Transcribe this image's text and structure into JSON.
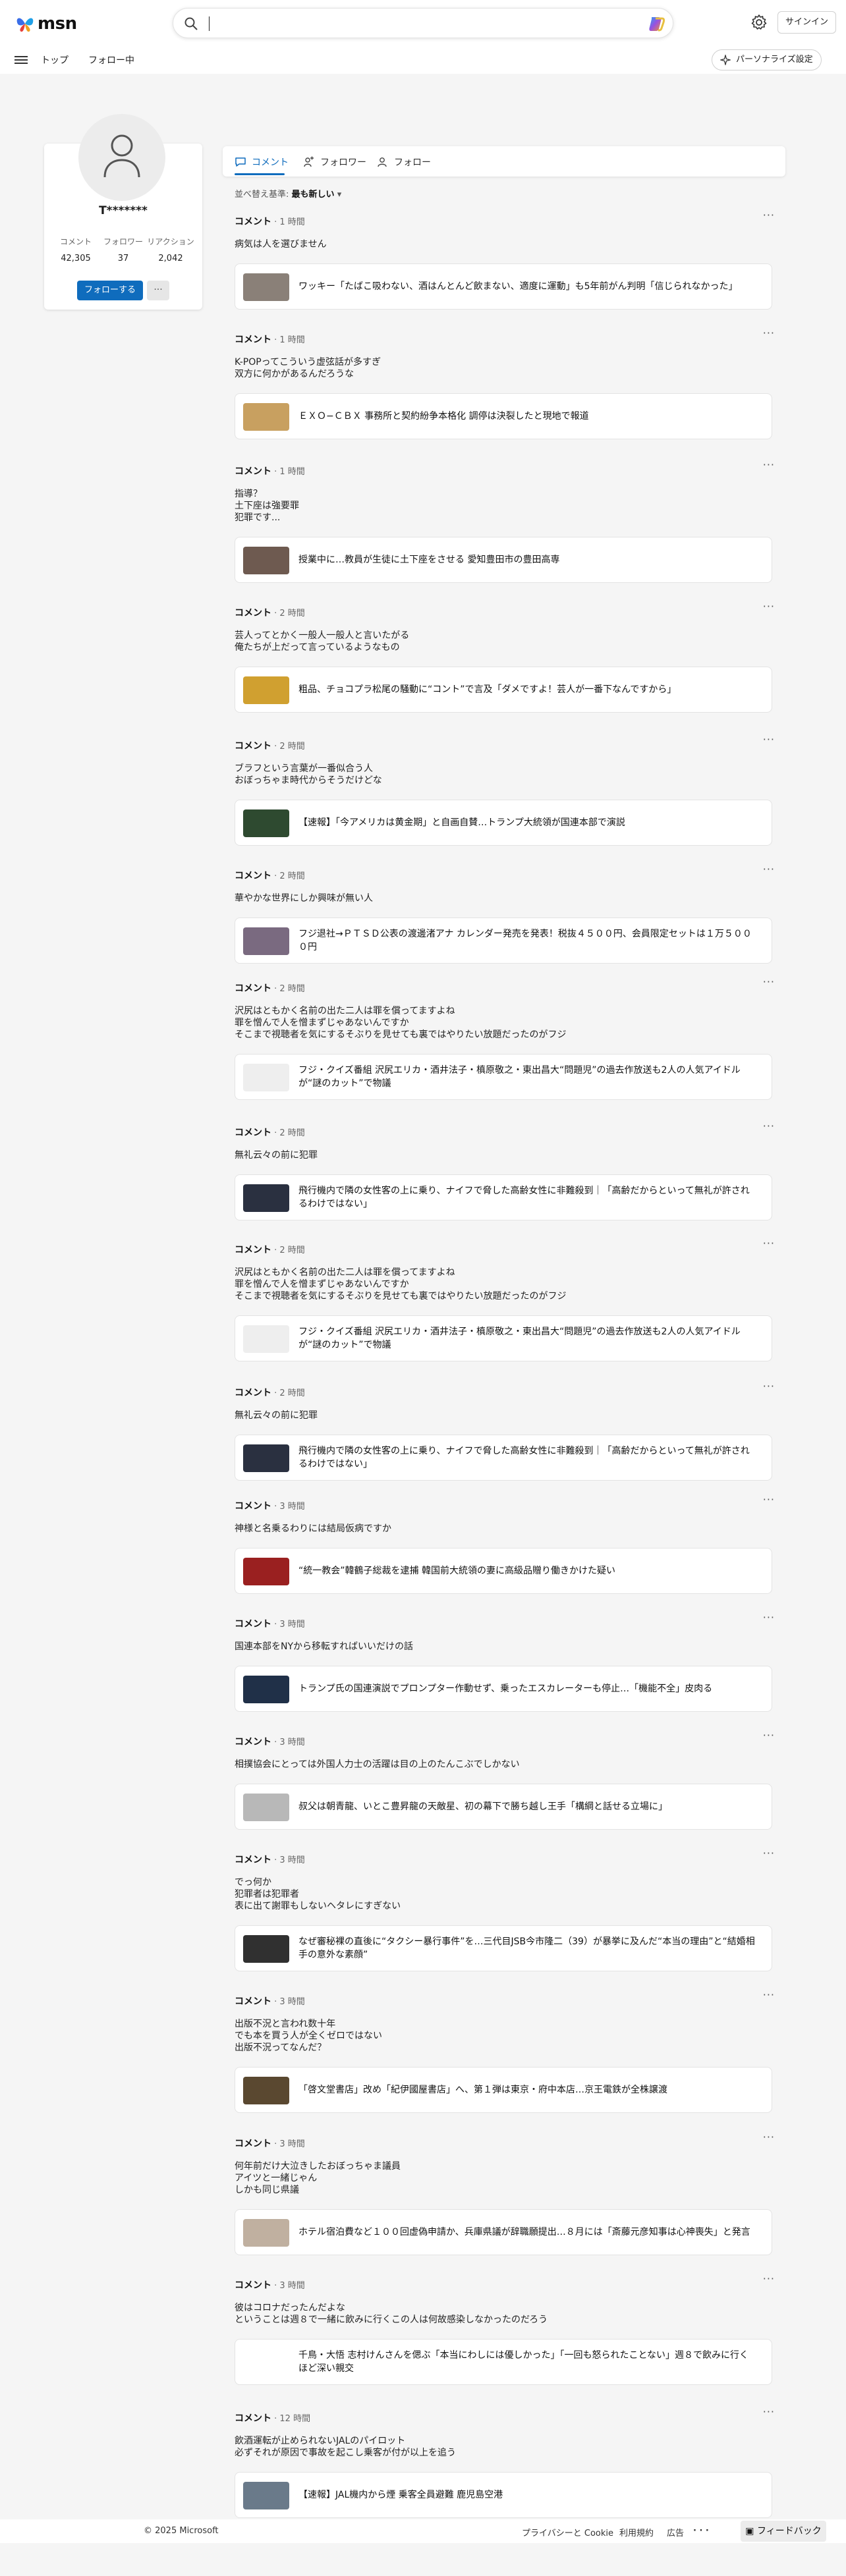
{
  "header": {
    "brand": "msn",
    "search": {
      "value": "",
      "placeholder": ""
    },
    "signin_label": "サインイン"
  },
  "nav": {
    "links": [
      "トップ",
      "フォロー中"
    ],
    "personalize_label": "パーソナライズ設定"
  },
  "profile": {
    "name": "T*******",
    "stats": [
      {
        "label": "コメント",
        "value": "42,305"
      },
      {
        "label": "フォロワー",
        "value": "37"
      },
      {
        "label": "リアクション",
        "value": "2,042"
      }
    ],
    "follow_label": "フォローする",
    "more_label": "···"
  },
  "tabs": [
    {
      "label": "コメント",
      "icon": "comment-icon",
      "active": true
    },
    {
      "label": "フォロワー",
      "icon": "followers-icon",
      "active": false
    },
    {
      "label": "フォロー",
      "icon": "following-icon",
      "active": false
    }
  ],
  "sort": {
    "label": "並べ替え基準:",
    "value": "最も新しい"
  },
  "feed": [
    {
      "kind": "コメント",
      "time": "1 時間",
      "text": "病気は人を選びません",
      "article": "ワッキー「たばこ吸わない、酒はんとんど飲まない、適度に運動」も5年前がん判明「信じられなかった」",
      "thumb": "#8a8078"
    },
    {
      "kind": "コメント",
      "time": "1 時間",
      "text": "K-POPってこういう虚弦話が多すぎ\n双方に何かがあるんだろうな",
      "article": "ＥＸＯ−ＣＢＸ 事務所と契約紛争本格化 調停は決裂したと現地で報道",
      "thumb": "#c8a060"
    },
    {
      "kind": "コメント",
      "time": "1 時間",
      "text": "指導？\n土下座は強要罪\n犯罪です...",
      "article": "授業中に…教員が生徒に土下座をさせる 愛知豊田市の豊田高専",
      "thumb": "#6e5a50"
    },
    {
      "kind": "コメント",
      "time": "2 時間",
      "text": "芸人ってとかく一般人一般人と言いたがる\n俺たちが上だって言っているようなもの",
      "article": "粗品、チョコプラ松尾の騒動に“コント”で言及「ダメですよ！芸人が一番下なんですから」",
      "thumb": "#d0a030"
    },
    {
      "kind": "コメント",
      "time": "2 時間",
      "text": "ブラフという言葉が一番似合う人\nおぼっちゃま時代からそうだけどな",
      "article": "【速報】「今アメリカは黄金期」と自画自賛…トランプ大統領が国連本部で演説",
      "thumb": "#2e4a30"
    },
    {
      "kind": "コメント",
      "time": "2 時間",
      "text": "華やかな世界にしか興味が無い人",
      "article": "フジ退社→ＰＴＳＤ公表の渡邊渚アナ カレンダー発売を発表！税抜４５００円、会員限定セットは１万５０００円",
      "thumb": "#7a6a80"
    },
    {
      "kind": "コメント",
      "time": "2 時間",
      "text": "沢尻はともかく名前の出た二人は罪を償ってますよね\n罪を憎んで人を憎まずじゃあないんですか\nそこまで視聴者を気にするそぶりを見せても裏ではやりたい放題だったのがフジ",
      "article": "フジ・クイズ番組 沢尻エリカ・酒井法子・槙原敬之・東出昌大“問題児”の過去作放送も2人の人気アイドルが“謎のカット”で物議",
      "thumb": "#eeeeee"
    },
    {
      "kind": "コメント",
      "time": "2 時間",
      "text": "無礼云々の前に犯罪",
      "article": "飛行機内で隣の女性客の上に乗り、ナイフで脅した高齢女性に非難殺到｜「高齢だからといって無礼が許されるわけではない」",
      "thumb": "#2a3040"
    },
    {
      "kind": "コメント",
      "time": "2 時間",
      "text": "沢尻はともかく名前の出た二人は罪を償ってますよね\n罪を憎んで人を憎まずじゃあないんですか\nそこまで視聴者を気にするそぶりを見せても裏ではやりたい放題だったのがフジ",
      "article": "フジ・クイズ番組 沢尻エリカ・酒井法子・槙原敬之・東出昌大“問題児”の過去作放送も2人の人気アイドルが“謎のカット”で物議",
      "thumb": "#eeeeee"
    },
    {
      "kind": "コメント",
      "time": "2 時間",
      "text": "無礼云々の前に犯罪",
      "article": "飛行機内で隣の女性客の上に乗り、ナイフで脅した高齢女性に非難殺到｜「高齢だからといって無礼が許されるわけではない」",
      "thumb": "#2a3040"
    },
    {
      "kind": "コメント",
      "time": "3 時間",
      "text": "神様と名乗るわりには結局仮病ですか",
      "article": "“統一教会”韓鶴子総裁を逮捕 韓国前大統領の妻に高級品贈り働きかけた疑い",
      "thumb": "#9a2020"
    },
    {
      "kind": "コメント",
      "time": "3 時間",
      "text": "国連本部をNYから移転すればいいだけの話",
      "article": "トランプ氏の国連演説でプロンプター作動せず、乗ったエスカレーターも停止…「機能不全」皮肉る",
      "thumb": "#203048"
    },
    {
      "kind": "コメント",
      "time": "3 時間",
      "text": "相撲協会にとっては外国人力士の活躍は目の上のたんこぶでしかない",
      "article": "叔父は朝青龍、いとこ豊昇龍の天敵星、初の幕下で勝ち越し王手「構綱と話せる立場に」",
      "thumb": "#b8b8b8"
    },
    {
      "kind": "コメント",
      "time": "3 時間",
      "text": "でっ何か\n犯罪者は犯罪者\n表に出て謝罪もしないヘタレにすぎない",
      "article": "なぜ審秘裸の直後に“タクシー暴行事件”を…三代目JSB今市隆二（39）が暴挙に及んだ“本当の理由”と“結婚相手の意外な素顔”",
      "thumb": "#303030"
    },
    {
      "kind": "コメント",
      "time": "3 時間",
      "text": "出版不況と言われ数十年\nでも本を買う人が全くゼロではない\n出版不況ってなんだ？",
      "article": "「啓文堂書店」改め「紀伊國屋書店」へ、第１弾は東京・府中本店…京王電鉄が全株譲渡",
      "thumb": "#5a4830"
    },
    {
      "kind": "コメント",
      "time": "3 時間",
      "text": "何年前だけ大泣きしたおぼっちゃま議員\nアイツと一緒じゃん\nしかも同じ県議",
      "article": "ホテル宿泊費など１００回虚偽申請か、兵庫県議が辞職願提出…８月には「斎藤元彦知事は心神喪失」と発言",
      "thumb": "#c0b0a0"
    },
    {
      "kind": "コメント",
      "time": "3 時間",
      "text": "彼はコロナだったんだよな\nということは週８で一緒に飲みに行くこの人は何故感染しなかったのだろう",
      "article": "千鳥・大悟 志村けんさんを偲ぶ「本当にわしには優しかった」「一回も怒られたことない」週８で飲みに行くほど深い親交",
      "thumb": "#ffffff"
    },
    {
      "kind": "コメント",
      "time": "12 時間",
      "text": "飲酒運転が止められないJALのパイロット\n必ずそれが原因で事故を起こし乗客が付が以上を追う",
      "article": "【速報】JAL機内から煙 乗客全員避難 鹿児島空港",
      "thumb": "#6a7a8a"
    }
  ],
  "footer": {
    "copyright": "© 2025 Microsoft",
    "links": [
      "プライバシーと Cookie",
      "利用規約",
      "広告",
      "· · ·"
    ],
    "feedback_label": "フィードバック"
  }
}
